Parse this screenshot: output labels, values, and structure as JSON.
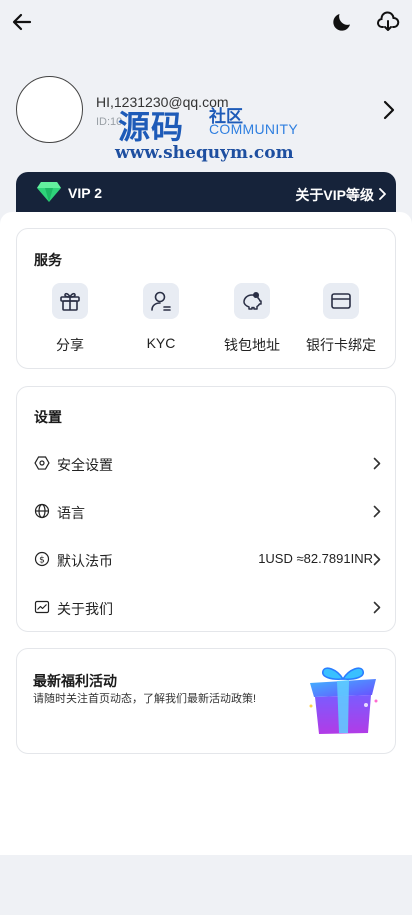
{
  "profile": {
    "greeting": "HI,1231230@qq.com",
    "id_label": "ID:10"
  },
  "watermark": {
    "brand_cn": "源码",
    "brand_cn2": "社区",
    "brand_en": "COMMUNITY",
    "url": "www.shequym.com"
  },
  "vip": {
    "level": "VIP 2",
    "link": "关于VIP等级"
  },
  "services": {
    "title": "服务",
    "items": [
      {
        "label": "分享",
        "icon": "gift-box-icon"
      },
      {
        "label": "KYC",
        "icon": "user-verify-icon"
      },
      {
        "label": "钱包地址",
        "icon": "piggy-bank-icon"
      },
      {
        "label": "银行卡绑定",
        "icon": "bank-card-icon"
      }
    ]
  },
  "settings": {
    "title": "设置",
    "items": [
      {
        "label": "安全设置",
        "icon": "shield-hex-icon",
        "value": ""
      },
      {
        "label": "语言",
        "icon": "globe-icon",
        "value": ""
      },
      {
        "label": "默认法币",
        "icon": "dollar-coin-icon",
        "value": "1USD ≈82.7891INR"
      },
      {
        "label": "关于我们",
        "icon": "info-chart-icon",
        "value": ""
      }
    ]
  },
  "promo": {
    "title": "最新福利活动",
    "desc": "请随时关注首页动态，了解我们最新活动政策!"
  },
  "colors": {
    "accent": "#16233a",
    "watermark_blue": "#1e5bb8",
    "page_bg": "#eff1f5",
    "tile_bg": "#e8ecf3"
  }
}
